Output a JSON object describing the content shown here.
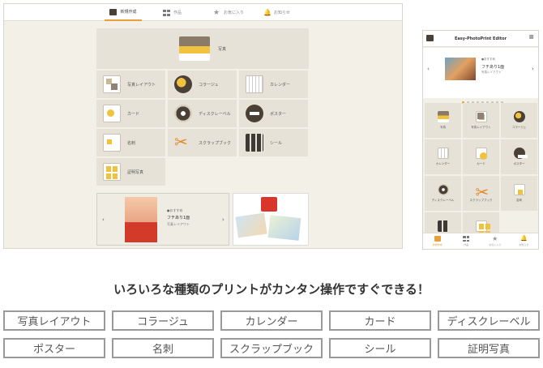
{
  "desktop": {
    "tabs": [
      {
        "label": "新規作成",
        "icon": "new-icon",
        "active": true
      },
      {
        "label": "作品",
        "icon": "grid-icon",
        "active": false
      },
      {
        "label": "お気に入り",
        "icon": "star-icon",
        "active": false
      },
      {
        "label": "お知らせ",
        "icon": "bell-icon",
        "active": false
      }
    ],
    "top_item": {
      "label": "写真"
    },
    "items": [
      {
        "label": "写真レイアウト"
      },
      {
        "label": "コラージュ"
      },
      {
        "label": "カレンダー"
      },
      {
        "label": "カード"
      },
      {
        "label": "ディスクレーベル"
      },
      {
        "label": "ポスター"
      },
      {
        "label": "名刺"
      },
      {
        "label": "スクラップブック"
      },
      {
        "label": "シール"
      },
      {
        "label": "証明写真"
      }
    ],
    "feature": {
      "small": "●おすすめ",
      "title": "フチあり1面",
      "sub": "写真レイアウト"
    }
  },
  "phone": {
    "title": "Easy-PhotoPrint Editor",
    "banner": {
      "small": "●おすすめ",
      "title": "フチあり1面",
      "sub": "写真レイアウト"
    },
    "items": [
      {
        "label": "写真"
      },
      {
        "label": "写真レイアウト"
      },
      {
        "label": "コラージュ"
      },
      {
        "label": "カレンダー"
      },
      {
        "label": "カード"
      },
      {
        "label": "ポスター"
      },
      {
        "label": "ディスクレーベル"
      },
      {
        "label": "スクラップブック"
      },
      {
        "label": "名刺"
      },
      {
        "label": "シール"
      },
      {
        "label": "証明写真"
      }
    ],
    "footer": [
      {
        "label": "新規作成",
        "active": true
      },
      {
        "label": "作品",
        "active": false
      },
      {
        "label": "お気に入り",
        "active": false
      },
      {
        "label": "お知らせ",
        "active": false
      }
    ]
  },
  "headline": "いろいろな種類のプリントがカンタン操作ですぐできる！",
  "chips": [
    "写真レイアウト",
    "コラージュ",
    "カレンダー",
    "カード",
    "ディスクレーベル",
    "ポスター",
    "名刺",
    "スクラップブック",
    "シール",
    "証明写真"
  ],
  "colors": {
    "accent": "#e8a13a",
    "tile": "#e6e2d8",
    "bg": "#f3f0e8"
  }
}
